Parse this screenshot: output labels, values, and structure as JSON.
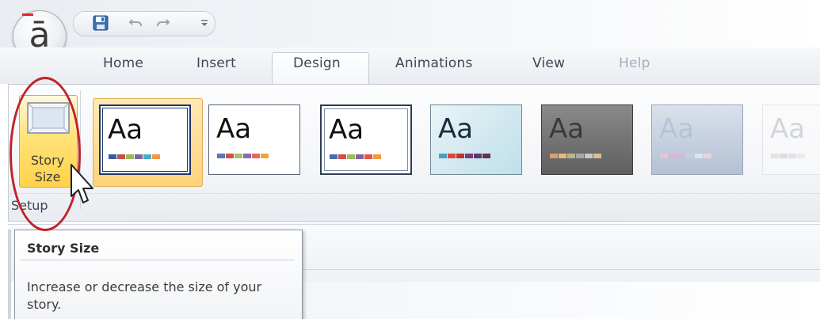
{
  "app": {
    "orb_glyph": "ā",
    "quick_access": {
      "save_icon": "save-icon",
      "undo_icon": "undo-icon",
      "redo_icon": "redo-icon",
      "customize_icon": "customize-qat-icon"
    }
  },
  "tabs": [
    {
      "label": "Home"
    },
    {
      "label": "Insert"
    },
    {
      "label": "Design",
      "active": true
    },
    {
      "label": "Animations"
    },
    {
      "label": "View"
    },
    {
      "label": "Help",
      "disabled": true
    }
  ],
  "ribbon": {
    "setup_group": {
      "label": "Setup",
      "story_size_button": {
        "label_line1": "Story",
        "label_line2": "Size"
      }
    },
    "themes": [
      {
        "label": "Aa",
        "selected": true
      },
      {
        "label": "Aa"
      },
      {
        "label": "Aa"
      },
      {
        "label": "Aa"
      },
      {
        "label": "Aa"
      },
      {
        "label": "Aa"
      },
      {
        "label": "Aa"
      }
    ]
  },
  "tooltip": {
    "title": "Story Size",
    "body": "Increase or decrease the size of your story."
  },
  "colors": {
    "highlight_oval": "#c0232a",
    "button_hover": "#ffd24a",
    "tab_text": "#3c4653"
  }
}
